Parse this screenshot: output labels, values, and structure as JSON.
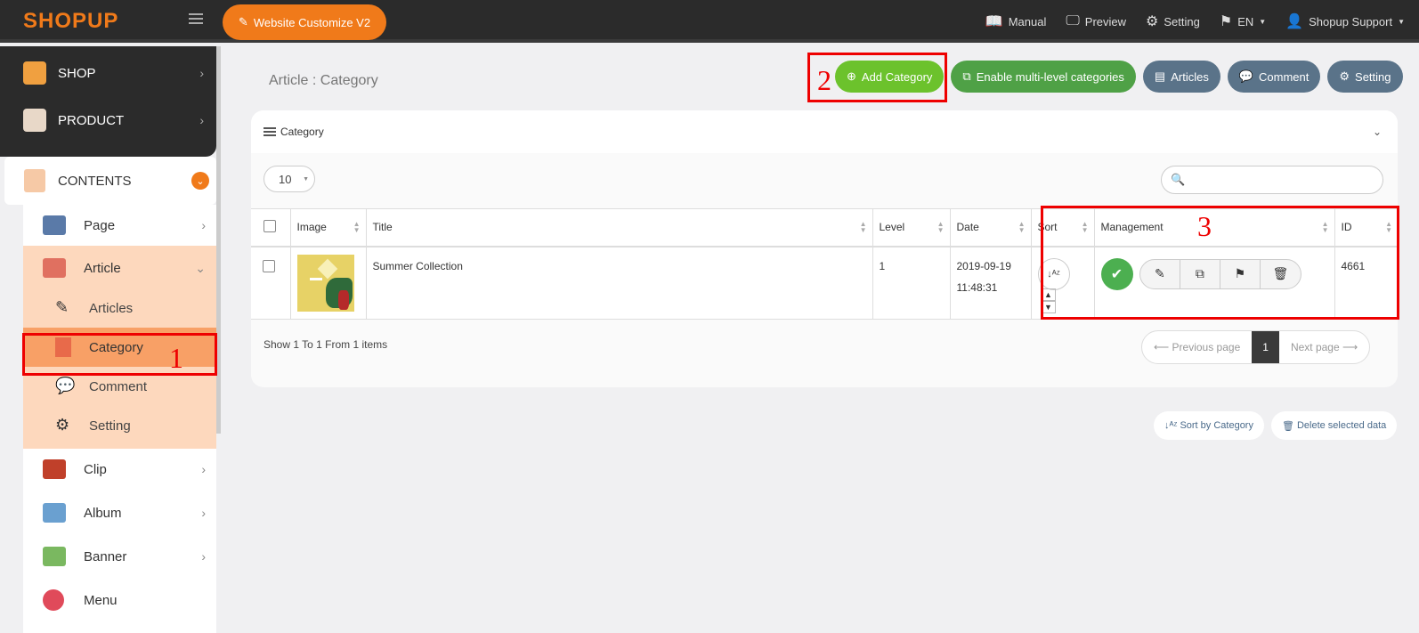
{
  "brand": {
    "logo": "SHOPUP",
    "customize_label": "Website Customize V2"
  },
  "topnav": [
    {
      "icon": "book-icon",
      "glyph": "📖",
      "label": "Manual"
    },
    {
      "icon": "monitor-icon",
      "glyph": "🖵",
      "label": "Preview"
    },
    {
      "icon": "gear-icon",
      "glyph": "⚙",
      "label": "Setting"
    },
    {
      "icon": "flag-icon",
      "glyph": "⚑",
      "label": "EN"
    },
    {
      "icon": "person-icon",
      "glyph": "👤",
      "label": "Shopup Support"
    }
  ],
  "sidebar": {
    "shop": "SHOP",
    "product": "PRODUCT",
    "contents": "CONTENTS",
    "page": "Page",
    "article": "Article",
    "articles": "Articles",
    "category": "Category",
    "comment": "Comment",
    "setting": "Setting",
    "clip": "Clip",
    "album": "Album",
    "banner": "Banner",
    "menu": "Menu"
  },
  "annotations": {
    "one": "1",
    "two": "2",
    "three": "3"
  },
  "page_title": "Article : Category",
  "actions": {
    "add_category": "Add Category",
    "multi_level": "Enable multi-level categories",
    "articles": "Articles",
    "comment": "Comment",
    "setting": "Setting"
  },
  "card": {
    "title": "Category",
    "per_page": "10",
    "search_placeholder": "",
    "columns": [
      "Image",
      "Title",
      "Level",
      "Date",
      "Sort",
      "Management",
      "ID"
    ],
    "rows": [
      {
        "title": "Summer Collection",
        "level": "1",
        "date": "2019-09-19",
        "time": "11:48:31",
        "id": "4661"
      }
    ],
    "show_info": "Show 1 To 1 From 1 items",
    "pager": {
      "prev": "⟵ Previous page",
      "current": "1",
      "next": "Next page ⟶"
    }
  },
  "bottom": {
    "sort_by_category": "Sort by Category",
    "delete_selected": "Delete selected data"
  },
  "colors": {
    "brand_orange": "#f07a1a",
    "green": "#6cc22c",
    "slate": "#5a7389",
    "annotation_red": "#e00000"
  }
}
